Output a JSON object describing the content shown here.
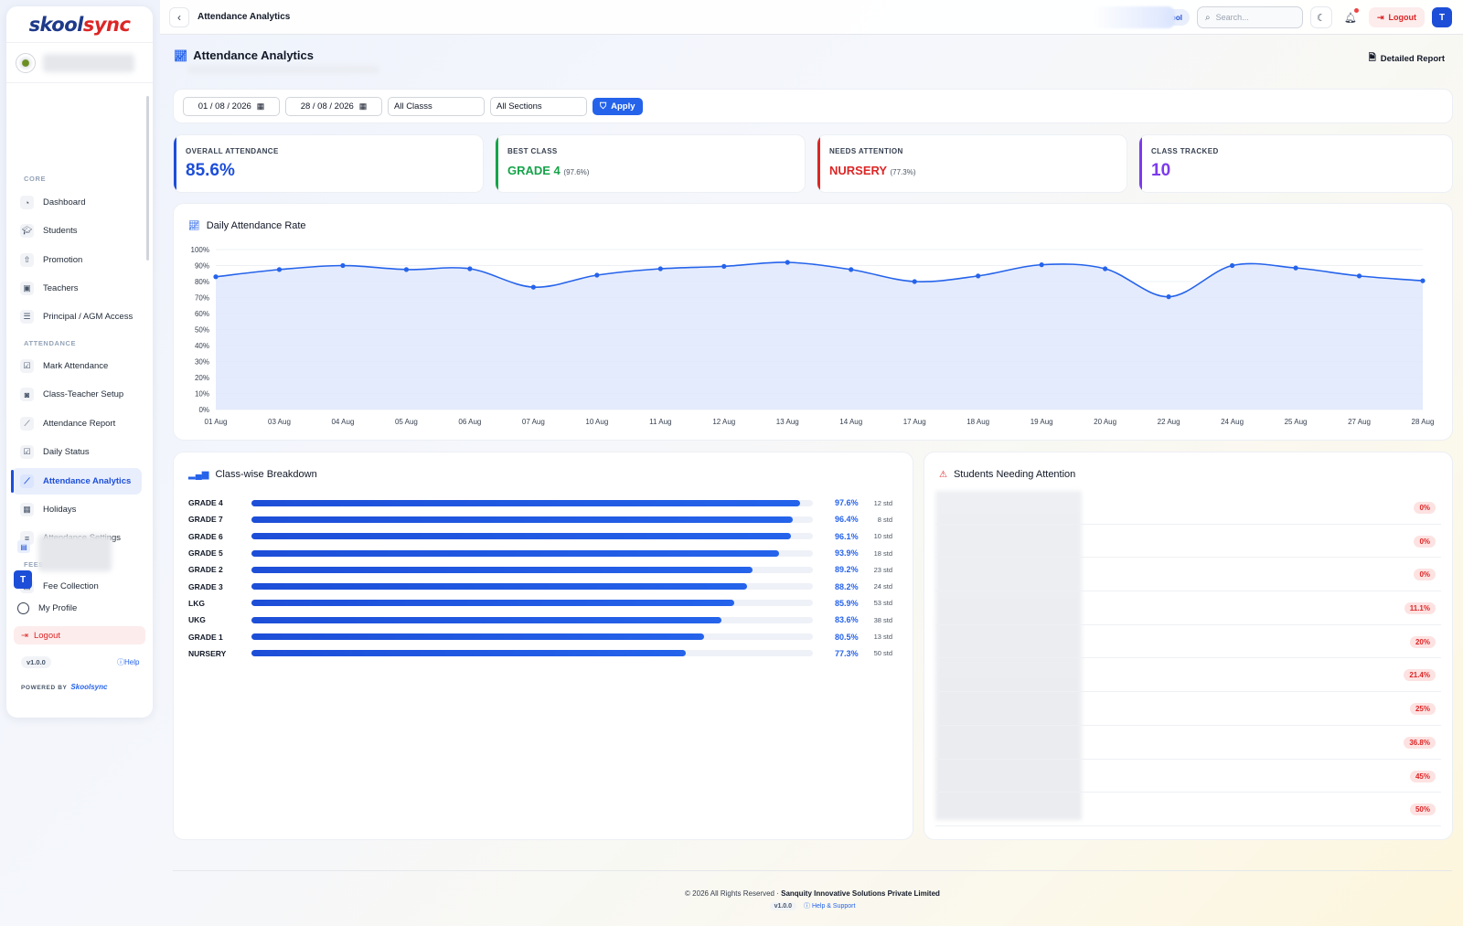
{
  "sidebar": {
    "logo_a": "skool",
    "logo_b": "sync",
    "sections": [
      "CORE",
      "ATTENDANCE",
      "FEES"
    ],
    "items": [
      {
        "label": "Dashboard",
        "icon": "gauge-icon"
      },
      {
        "label": "Students",
        "icon": "graduation-cap-icon"
      },
      {
        "label": "Promotion",
        "icon": "arrow-up-circle-icon"
      },
      {
        "label": "Teachers",
        "icon": "id-badge-icon"
      },
      {
        "label": "Principal / AGM Access",
        "icon": "sliders-icon"
      },
      {
        "label": "Mark Attendance",
        "icon": "calendar-check-icon"
      },
      {
        "label": "Class-Teacher Setup",
        "icon": "user-badge-icon"
      },
      {
        "label": "Attendance Report",
        "icon": "line-chart-icon"
      },
      {
        "label": "Daily Status",
        "icon": "calendar-check-icon"
      },
      {
        "label": "Attendance Analytics",
        "icon": "trend-chart-icon"
      },
      {
        "label": "Holidays",
        "icon": "calendar-icon"
      },
      {
        "label": "Attendance Settings",
        "icon": "settings-sliders-icon"
      },
      {
        "label": "Fee Collection",
        "icon": "wallet-icon"
      }
    ],
    "user_initial": "T",
    "profile_label": "My Profile",
    "logout_label": "Logout",
    "version": "v1.0.0",
    "help_label": "Help",
    "powered_by": "POWERED BY",
    "powered_brand": "Skoolsync"
  },
  "topbar": {
    "title": "Attendance Analytics",
    "school_pill": "ool",
    "search_placeholder": "Search...",
    "logout_label": "Logout",
    "avatar_initial": "T"
  },
  "page": {
    "title": "Attendance Analytics",
    "detailed_report": "Detailed Report"
  },
  "filters": {
    "from_date": "01 / 08 / 2026",
    "to_date": "28 / 08 / 2026",
    "class_value": "All Classs",
    "section_value": "All Sections",
    "apply_label": "Apply"
  },
  "kpis": [
    {
      "label": "OVERALL ATTENDANCE",
      "value": "85.6%",
      "sub": "",
      "color": "#1d4ed8"
    },
    {
      "label": "BEST CLASS",
      "value": "GRADE 4",
      "sub": "(97.6%)",
      "color": "#16a34a"
    },
    {
      "label": "NEEDS ATTENTION",
      "value": "NURSERY",
      "sub": "(77.3%)",
      "color": "#dc2626"
    },
    {
      "label": "CLASS TRACKED",
      "value": "10",
      "sub": "",
      "color": "#7c3aed"
    }
  ],
  "daily_chart": {
    "title": "Daily Attendance Rate"
  },
  "chart_data": {
    "type": "area",
    "title": "Daily Attendance Rate",
    "x": [
      "01 Aug",
      "03 Aug",
      "04 Aug",
      "05 Aug",
      "06 Aug",
      "07 Aug",
      "10 Aug",
      "11 Aug",
      "12 Aug",
      "13 Aug",
      "14 Aug",
      "17 Aug",
      "18 Aug",
      "19 Aug",
      "20 Aug",
      "22 Aug",
      "24 Aug",
      "25 Aug",
      "27 Aug",
      "28 Aug"
    ],
    "values": [
      83,
      87.5,
      90,
      87.5,
      88,
      76.5,
      84,
      88,
      89.5,
      92,
      87.5,
      80,
      83.5,
      90.5,
      88,
      70.5,
      90,
      88.5,
      83.5,
      80.5
    ],
    "yticks": [
      "0%",
      "10%",
      "20%",
      "30%",
      "40%",
      "50%",
      "60%",
      "70%",
      "80%",
      "90%",
      "100%"
    ],
    "ylim": [
      0,
      100
    ],
    "grid": true,
    "color": "#2563eb"
  },
  "breakdown": {
    "title": "Class-wise Breakdown",
    "rows": [
      {
        "name": "GRADE 4",
        "pct": 97.6,
        "pct_label": "97.6%",
        "std": "12 std"
      },
      {
        "name": "GRADE 7",
        "pct": 96.4,
        "pct_label": "96.4%",
        "std": "8 std"
      },
      {
        "name": "GRADE 6",
        "pct": 96.1,
        "pct_label": "96.1%",
        "std": "10 std"
      },
      {
        "name": "GRADE 5",
        "pct": 93.9,
        "pct_label": "93.9%",
        "std": "18 std"
      },
      {
        "name": "GRADE 2",
        "pct": 89.2,
        "pct_label": "89.2%",
        "std": "23 std"
      },
      {
        "name": "GRADE 3",
        "pct": 88.2,
        "pct_label": "88.2%",
        "std": "24 std"
      },
      {
        "name": "LKG",
        "pct": 85.9,
        "pct_label": "85.9%",
        "std": "53 std"
      },
      {
        "name": "UKG",
        "pct": 83.6,
        "pct_label": "83.6%",
        "std": "38 std"
      },
      {
        "name": "GRADE 1",
        "pct": 80.5,
        "pct_label": "80.5%",
        "std": "13 std"
      },
      {
        "name": "NURSERY",
        "pct": 77.3,
        "pct_label": "77.3%",
        "std": "50 std"
      }
    ]
  },
  "attention": {
    "title": "Students Needing Attention",
    "values": [
      "0%",
      "0%",
      "0%",
      "11.1%",
      "20%",
      "21.4%",
      "25%",
      "36.8%",
      "45%",
      "50%"
    ]
  },
  "footer": {
    "copyright": "© 2026 All Rights Reserved ·",
    "company": "Sanquity Innovative Solutions Private Limited",
    "version": "v1.0.0",
    "help": "Help & Support"
  }
}
